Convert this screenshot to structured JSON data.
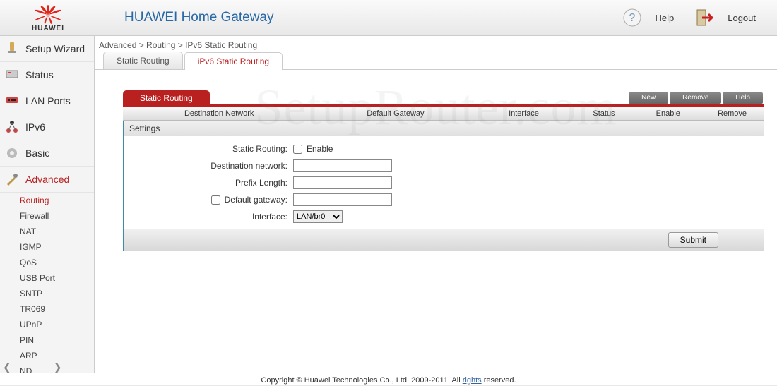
{
  "header": {
    "brand": "HUAWEI",
    "title": "HUAWEI Home Gateway",
    "help": "Help",
    "logout": "Logout"
  },
  "nav": {
    "items": [
      {
        "label": "Setup Wizard"
      },
      {
        "label": "Status"
      },
      {
        "label": "LAN Ports"
      },
      {
        "label": "IPv6"
      },
      {
        "label": "Basic"
      },
      {
        "label": "Advanced"
      }
    ],
    "advanced_sub": [
      "Routing",
      "Firewall",
      "NAT",
      "IGMP",
      "QoS",
      "USB Port",
      "SNTP",
      "TR069",
      "UPnP",
      "PIN",
      "ARP",
      "ND"
    ]
  },
  "breadcrumb": "Advanced > Routing > IPv6 Static Routing",
  "tabs": {
    "t0": "Static Routing",
    "t1": "iPv6 Static Routing"
  },
  "section": {
    "title": "Static Routing",
    "actions": {
      "new": "New",
      "remove": "Remove",
      "help": "Help"
    }
  },
  "cols": {
    "c0": "Destination Network",
    "c1": "Default Gateway",
    "c2": "Interface",
    "c3": "Status",
    "c4": "Enable",
    "c5": "Remove"
  },
  "panel": {
    "label": "Settings"
  },
  "form": {
    "static_routing_label": "Static Routing:",
    "enable_label": "Enable",
    "dest_label": "Destination network:",
    "prefix_label": "Prefix Length:",
    "gateway_label": "Default gateway:",
    "interface_label": "Interface:",
    "interface_value": "LAN/br0",
    "submit": "Submit"
  },
  "watermark": "SetupRouter.com",
  "footer": {
    "pre": "Copyright © Huawei Technologies Co., Ltd. 2009-2011. All ",
    "rights": "rights",
    "post": " reserved."
  }
}
